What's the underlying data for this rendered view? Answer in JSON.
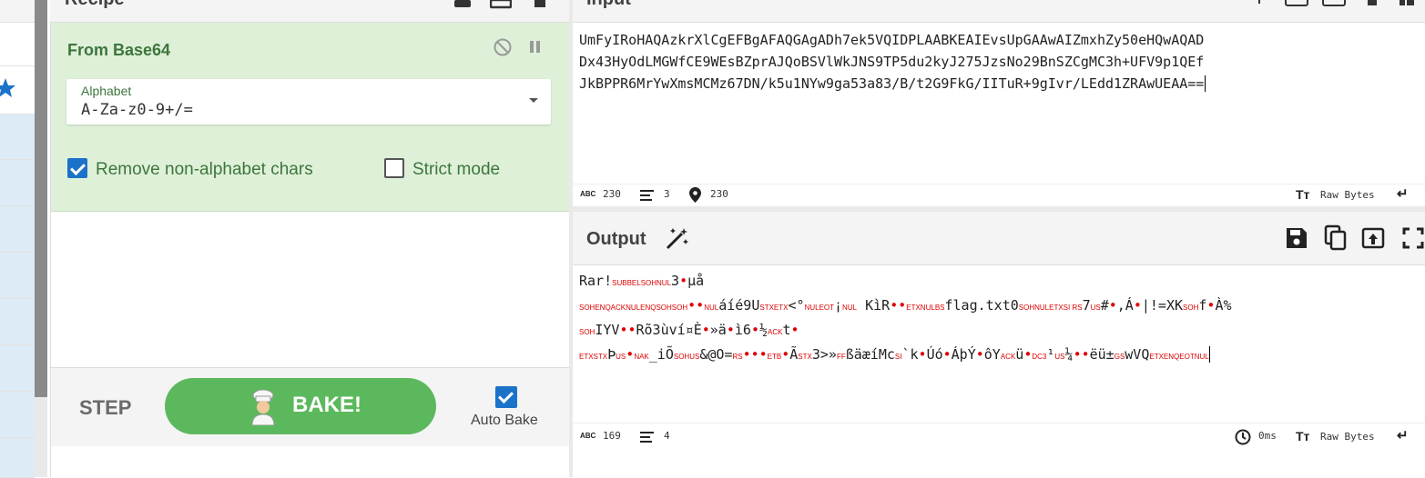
{
  "recipe": {
    "header_title": "Recipe",
    "operation": {
      "title": "From Base64",
      "alphabet_label": "Alphabet",
      "alphabet_value": "A-Za-z0-9+/=",
      "remove_non_alphabet_label": "Remove non-alphabet chars",
      "remove_non_alphabet_checked": true,
      "strict_mode_label": "Strict mode",
      "strict_mode_checked": false
    },
    "step_label": "STEP",
    "bake_label": "BAKE!",
    "auto_bake_label": "Auto Bake",
    "auto_bake_checked": true
  },
  "input": {
    "header_title": "Input",
    "lines": [
      "UmFyIRoHAQAzkrXlCgEFBgAFAQGAgADh7ek5VQIDPLAABKEAIEvsUpGAAwAIZmxhZy50eHQwAQAD",
      "Dx43HyOdLMGWfCE9WEsBZprAJQoBSVlWkJNS9TP5du2kyJ275JzsNo29BnSZCgMC3h+UFV9p1QEf",
      "JkBPPR6MrYwXmsMCMz67DN/k5u1NYw9ga53a83/B/t2G9FkG/IITuR+9gIvr/LEdd1ZRAwUEAA=="
    ],
    "status": {
      "chars": "230",
      "lines": "3",
      "position": "230",
      "format": "Raw Bytes"
    }
  },
  "output": {
    "header_title": "Output",
    "status": {
      "chars": "169",
      "lines": "4",
      "time": "0ms",
      "format": "Raw Bytes"
    }
  },
  "colors": {
    "accent_green": "#5cb85c",
    "op_bg": "#dff0d8",
    "checkbox_blue": "#1a73c8",
    "control_char_red": "#d00000"
  }
}
